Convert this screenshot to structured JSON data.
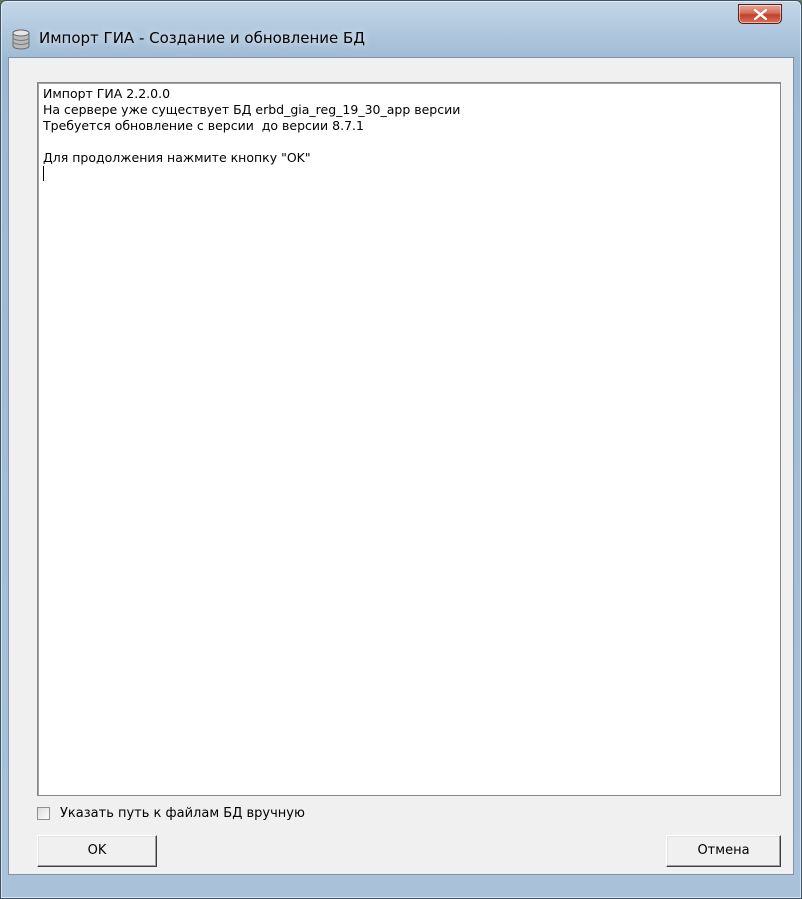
{
  "window": {
    "title": "Импорт ГИА - Создание и обновление БД",
    "close_label": "X"
  },
  "log": {
    "lines": [
      "Импорт ГИА 2.2.0.0",
      "На сервере уже существует БД erbd_gia_reg_19_30_app версии",
      "Требуется обновление с версии  до версии 8.7.1",
      "",
      "Для продолжения нажмите кнопку \"OK\""
    ]
  },
  "options": {
    "manual_path_label": "Указать путь к файлам БД вручную",
    "manual_path_checked": false
  },
  "buttons": {
    "ok_label": "OK",
    "cancel_label": "Отмена"
  },
  "icons": {
    "app": "database-icon",
    "close": "close-icon"
  },
  "colors": {
    "close_button": "#c24129",
    "titlebar": "#b4cbe0",
    "dialog_background": "#f0f0f0"
  }
}
